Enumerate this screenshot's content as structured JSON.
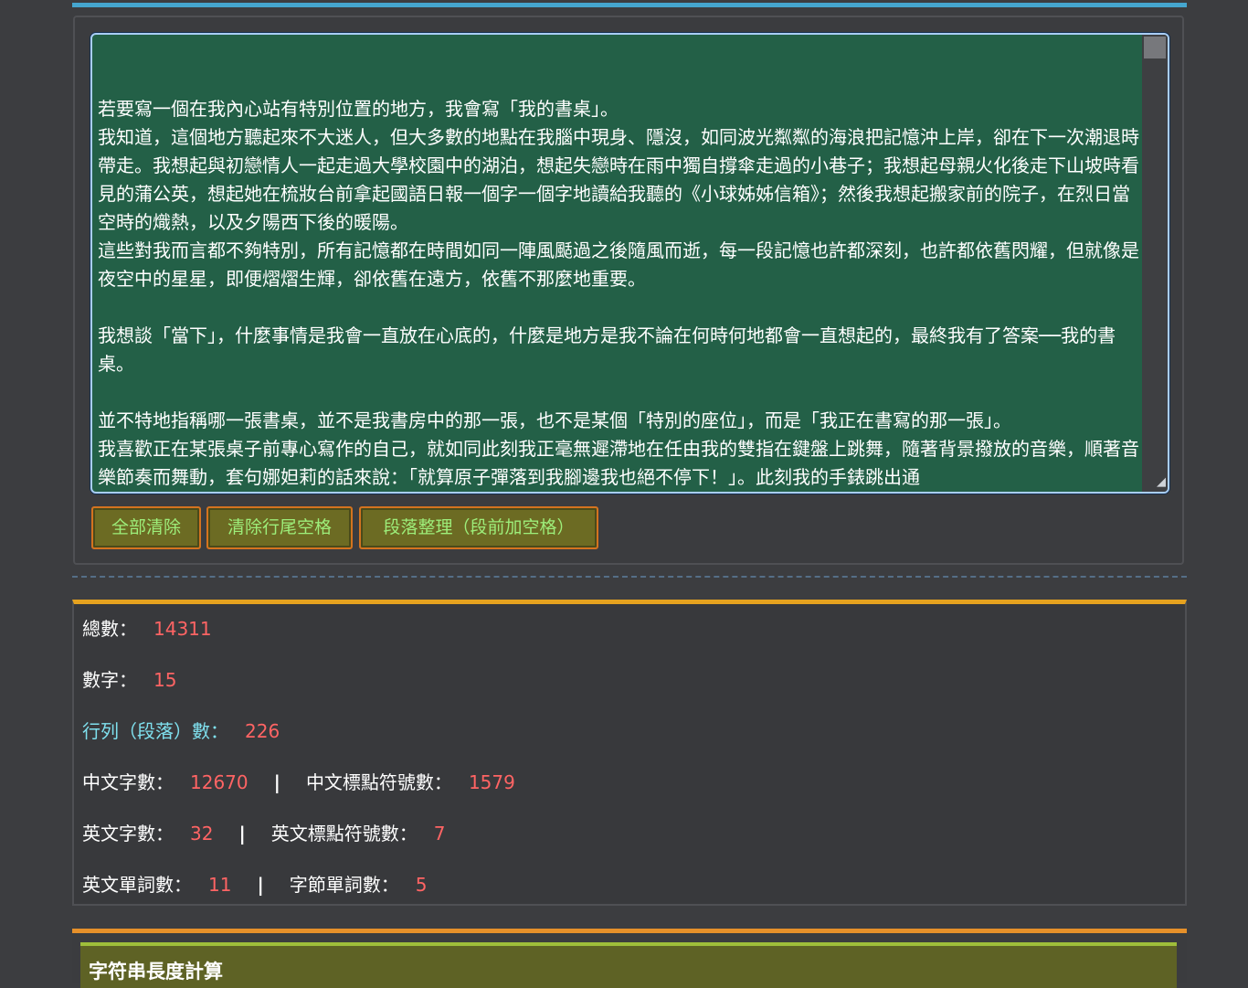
{
  "editor": {
    "text": "\n\n若要寫一個在我內心站有特別位置的地方，我會寫「我的書桌」。\n我知道，這個地方聽起來不大迷人，但大多數的地點在我腦中現身、隱沒，如同波光粼粼的海浪把記憶沖上岸，卻在下一次潮退時帶走。我想起與初戀情人一起走過大學校園中的湖泊，想起失戀時在雨中獨自撐傘走過的小巷子；我想起母親火化後走下山坡時看見的蒲公英，想起她在梳妝台前拿起國語日報一個字一個字地讀給我聽的《小球姊姊信箱》；然後我想起搬家前的院子，在烈日當空時的熾熱，以及夕陽西下後的暖陽。\n這些對我而言都不夠特別，所有記憶都在時間如同一陣風颳過之後隨風而逝，每一段記憶也許都深刻，也許都依舊閃耀，但就像是夜空中的星星，即便熠熠生輝，卻依舊在遠方，依舊不那麼地重要。\n\n我想談「當下」，什麼事情是我會一直放在心底的，什麼是地方是我不論在何時何地都會一直想起的，最終我有了答案──我的書桌。\n\n並不特地指稱哪一張書桌，並不是我書房中的那一張，也不是某個「特別的座位」，而是「我正在書寫的那一張」。\n我喜歡正在某張桌子前專心寫作的自己，就如同此刻我正毫無遲滯地在任由我的雙指在鍵盤上跳舞，隨著背景撥放的音樂，順著音樂節奏而舞動，套句娜妲莉的話來說：「就算原子彈落到我腳邊我也絕不停下！」。此刻我的手錶跳出通"
  },
  "buttons": {
    "clear_all": "全部清除",
    "trim_trailing": "清除行尾空格",
    "paragraph_format": "段落整理（段前加空格）"
  },
  "stats": {
    "total_label": "總數：",
    "total_value": "14311",
    "digits_label": "數字：",
    "digits_value": "15",
    "lines_label": "行列（段落）數：",
    "lines_value": "226",
    "cjk_chars_label": "中文字數：",
    "cjk_chars_value": "12670",
    "cjk_punct_label": "中文標點符號數：",
    "cjk_punct_value": "1579",
    "en_chars_label": "英文字數：",
    "en_chars_value": "32",
    "en_punct_label": "英文標點符號數：",
    "en_punct_value": "7",
    "en_words_label": "英文單詞數：",
    "en_words_value": "11",
    "byte_words_label": "字節單詞數：",
    "byte_words_value": "5",
    "separator": "|"
  },
  "length_section": {
    "title": "字符串長度計算"
  },
  "colors": {
    "accent_blue": "#45a6cf",
    "accent_orange": "#e6a21f",
    "editor_bg": "#236047",
    "value_red": "#ff6464",
    "button_text": "#9dee7a"
  }
}
